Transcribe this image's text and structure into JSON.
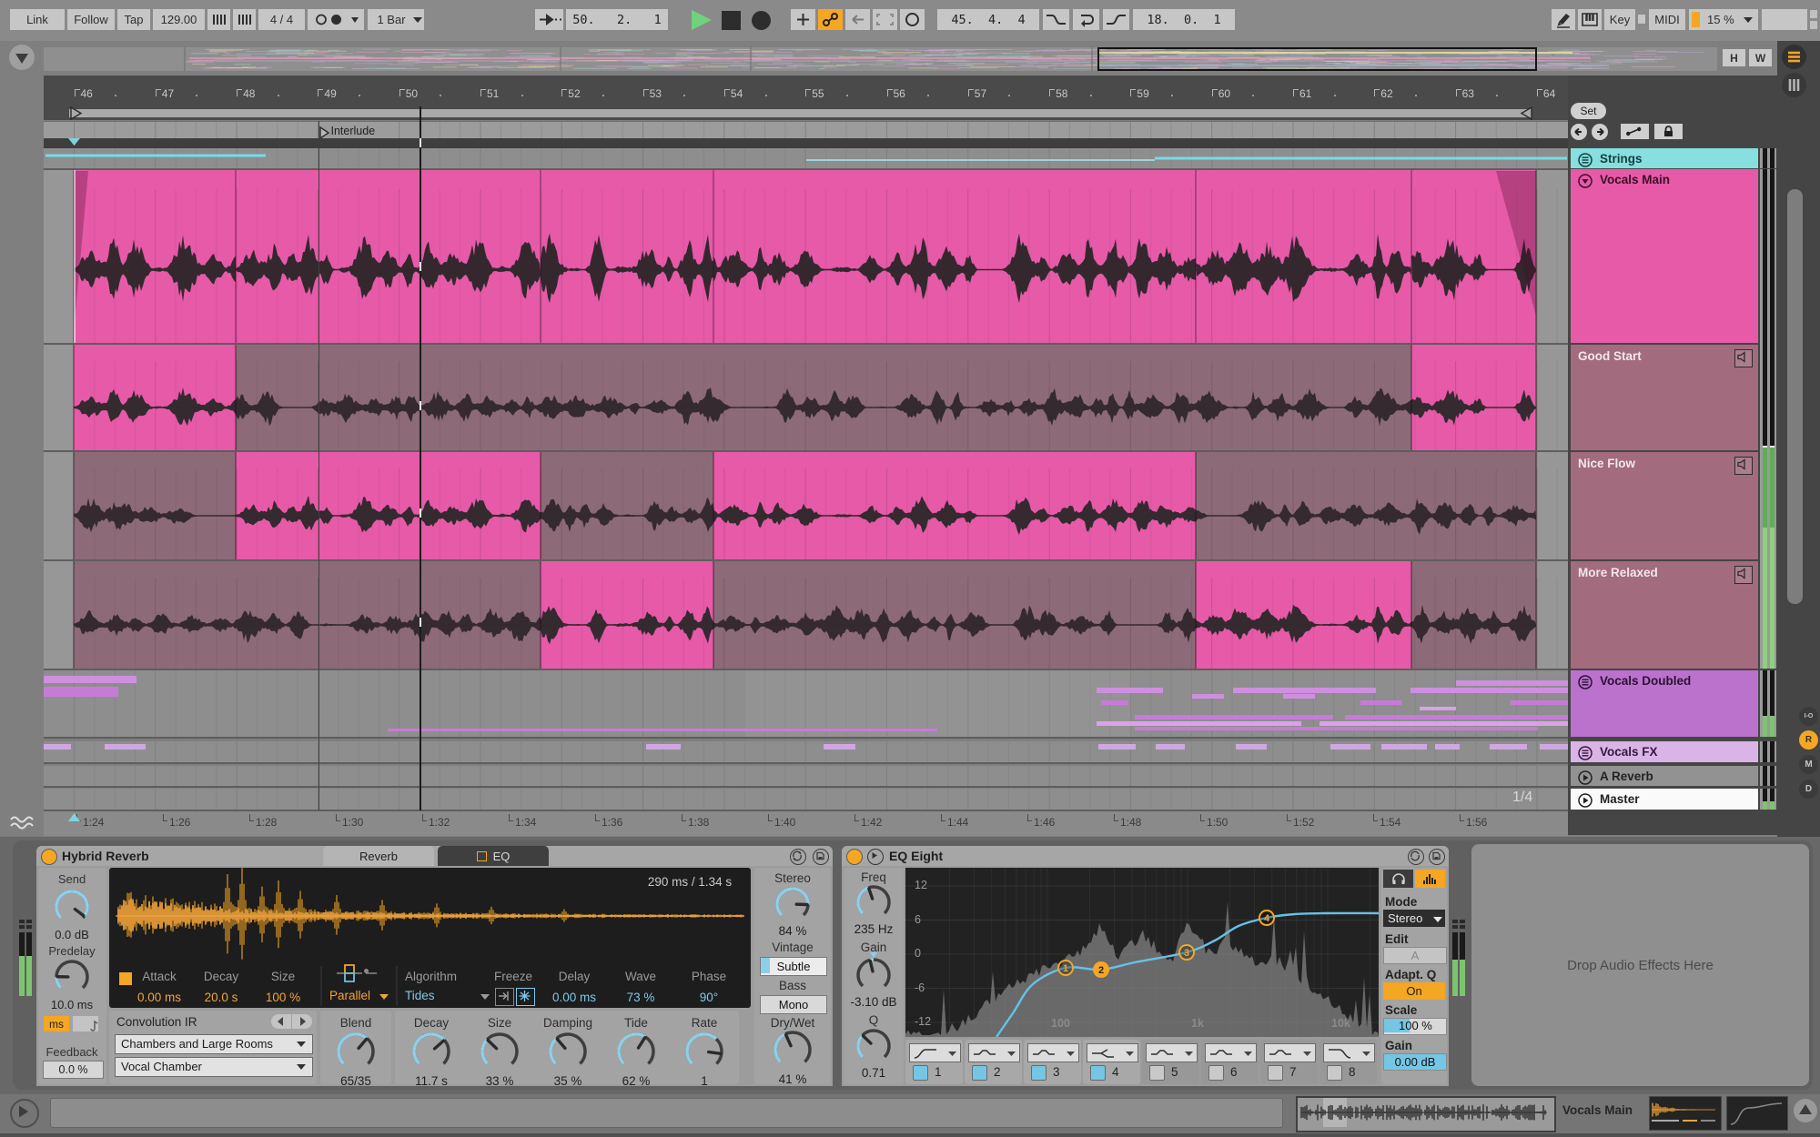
{
  "transport": {
    "link": "Link",
    "follow": "Follow",
    "tap": "Tap",
    "tempo": "129.00",
    "time_signature": "4 / 4",
    "quantization": "1 Bar",
    "arrangement_position": "50.   2.   1",
    "loop_start": "45.  4.  4",
    "loop_length": "18.  0.  1",
    "key": "Key",
    "midi": "MIDI",
    "cpu_load": "15 %"
  },
  "timeline": {
    "bars": [
      46,
      47,
      48,
      49,
      50,
      51,
      52,
      53,
      54,
      55,
      56,
      57,
      58,
      59,
      60,
      61,
      62,
      63,
      64
    ],
    "times": [
      "1:24",
      "1:26",
      "1:28",
      "1:30",
      "1:32",
      "1:34",
      "1:36",
      "1:38",
      "1:40",
      "1:42",
      "1:44",
      "1:46",
      "1:48",
      "1:50",
      "1:52",
      "1:54",
      "1:56"
    ],
    "locator": "Interlude",
    "set": "Set",
    "h": "H",
    "w": "W",
    "grid_interval": "1/4"
  },
  "tracks": {
    "strings": "Strings",
    "vocals_main": "Vocals Main",
    "take_lanes": [
      "Good Start",
      "Nice Flow",
      "More Relaxed"
    ],
    "vocals_doubled": "Vocals Doubled",
    "vocals_fx": "Vocals FX",
    "a_reverb": "A Reverb",
    "master": "Master"
  },
  "side_buttons": {
    "io": "I-O",
    "r": "R",
    "m": "M",
    "d": "D"
  },
  "hybrid_reverb": {
    "title": "Hybrid Reverb",
    "tab_reverb": "Reverb",
    "tab_eq": "EQ",
    "ir_time": "290 ms / 1.34 s",
    "send": {
      "label": "Send",
      "value": "0.0 dB"
    },
    "predelay": {
      "label": "Predelay",
      "value": "10.0 ms"
    },
    "ms_button": "ms",
    "feedback": {
      "label": "Feedback",
      "value": "0.0 %"
    },
    "attack": {
      "label": "Attack",
      "value": "0.00 ms"
    },
    "decay_ir": {
      "label": "Decay",
      "value": "20.0 s"
    },
    "size_ir": {
      "label": "Size",
      "value": "100 %"
    },
    "routing": "Parallel",
    "algorithm": {
      "label": "Algorithm",
      "value": "Tides"
    },
    "freeze_label": "Freeze",
    "delay": {
      "label": "Delay",
      "value": "0.00 ms"
    },
    "wave": {
      "label": "Wave",
      "value": "73 %"
    },
    "phase": {
      "label": "Phase",
      "value": "90°"
    },
    "convolution": {
      "label": "Convolution IR",
      "category": "Chambers and Large Rooms",
      "file": "Vocal Chamber"
    },
    "blend": {
      "label": "Blend",
      "value": "65/35"
    },
    "decay": {
      "label": "Decay",
      "value": "11.7 s"
    },
    "size": {
      "label": "Size",
      "value": "33 %"
    },
    "damping": {
      "label": "Damping",
      "value": "35 %"
    },
    "tide": {
      "label": "Tide",
      "value": "62 %"
    },
    "rate": {
      "label": "Rate",
      "value": "1"
    },
    "stereo": {
      "label": "Stereo",
      "value": "84 %"
    },
    "vintage": {
      "label": "Vintage",
      "value": "Subtle"
    },
    "bass": {
      "label": "Bass",
      "value": "Mono"
    },
    "drywet": {
      "label": "Dry/Wet",
      "value": "41 %"
    }
  },
  "eq_eight": {
    "title": "EQ Eight",
    "freq": {
      "label": "Freq",
      "value": "235 Hz"
    },
    "gain": {
      "label": "Gain",
      "value": "-3.10 dB"
    },
    "q": {
      "label": "Q",
      "value": "0.71"
    },
    "mode": {
      "label": "Mode",
      "value": "Stereo"
    },
    "edit": {
      "label": "Edit",
      "value": "A"
    },
    "adaptq": {
      "label": "Adapt. Q",
      "value": "On"
    },
    "scale": {
      "label": "Scale",
      "value": "100 %"
    },
    "gain_out": {
      "label": "Gain",
      "value": "0.00 dB"
    },
    "axis_db": [
      "12",
      "6",
      "0",
      "-6",
      "-12"
    ],
    "axis_freq": [
      "100",
      "1k",
      "10k"
    ],
    "bands": [
      "1",
      "2",
      "3",
      "4",
      "5",
      "6",
      "7",
      "8"
    ]
  },
  "device_drop_zone": "Drop Audio Effects Here",
  "status_bar": {
    "selected_clip": "Vocals Main"
  },
  "colors": {
    "accent_orange": "#f5a623",
    "clip_pink": "#e65aa8",
    "lane_dim": "#8d6a78",
    "cyan": "#7fd2e2",
    "play_green": "#6fd27f",
    "header_strings": "#87dfdf",
    "header_doubled": "#bb72cd",
    "header_fx": "#dab4e6",
    "meter_green": "#7cc46f"
  }
}
